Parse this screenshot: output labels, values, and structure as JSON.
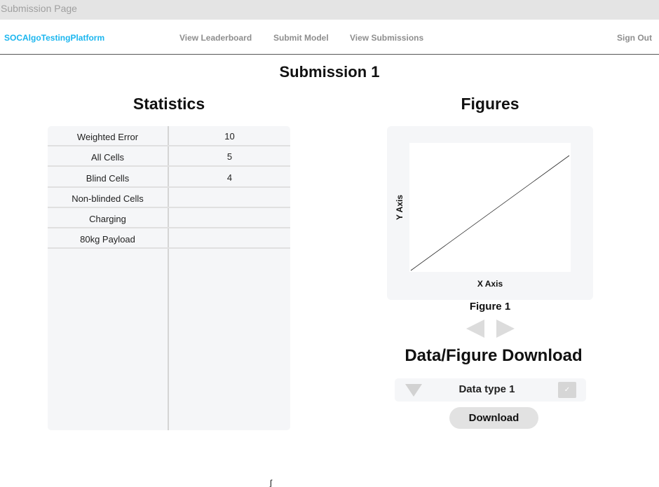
{
  "window": {
    "title": "Submission Page"
  },
  "navbar": {
    "brand": "SOCAlgoTestingPlatform",
    "links": [
      "View Leaderboard",
      "Submit Model",
      "View Submissions"
    ],
    "sign_out": "Sign Out"
  },
  "page": {
    "title": "Submission 1"
  },
  "statistics": {
    "heading": "Statistics",
    "rows": [
      {
        "label": "Weighted Error",
        "value": "10"
      },
      {
        "label": "All Cells",
        "value": "5"
      },
      {
        "label": "Blind Cells",
        "value": "4"
      },
      {
        "label": "Non-blinded Cells",
        "value": ""
      },
      {
        "label": "Charging",
        "value": ""
      },
      {
        "label": "80kg Payload",
        "value": ""
      }
    ]
  },
  "figures": {
    "heading": "Figures",
    "caption": "Figure 1",
    "chart_data": {
      "type": "line",
      "xlabel": "X Axis",
      "ylabel": "Y Axis",
      "series": [
        {
          "x": [
            0,
            1
          ],
          "y": [
            0,
            1
          ]
        }
      ]
    }
  },
  "download": {
    "heading": "Data/Figure Download",
    "selected_type": "Data type 1",
    "check_glyph": "✓",
    "button_label": "Download"
  },
  "colors": {
    "brand": "#1bb6ef",
    "nav_link": "#8e8e8e",
    "panel_bg": "#f5f6f8"
  },
  "stray_text": "ʃ"
}
